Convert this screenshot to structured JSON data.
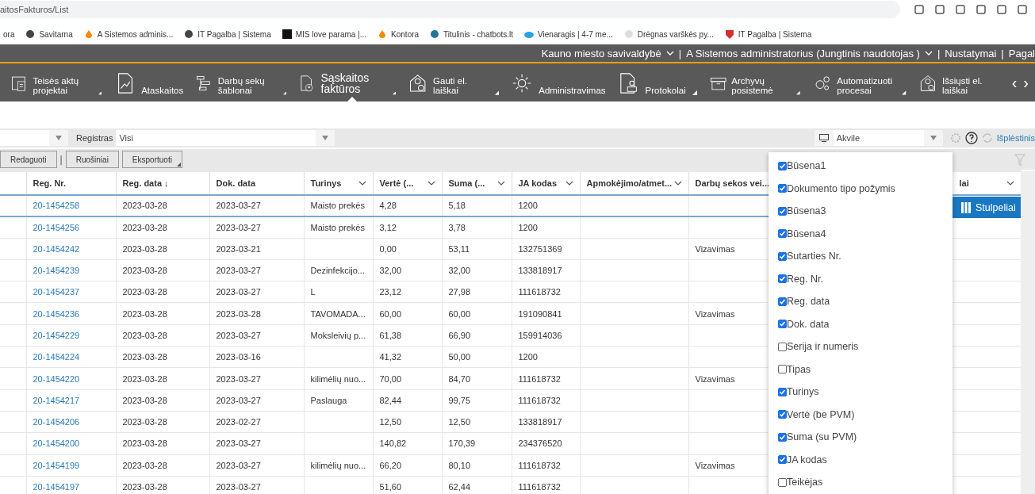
{
  "browser": {
    "url": "aitosFakturos/List",
    "bookmarks": [
      "ora",
      "Savitarna",
      "A Sistemos adminis...",
      "IT Pagalba | Sistema",
      "MIS love parama |...",
      "Kontora",
      "Titulinis - chatbots.lt",
      "Vienaragis | 4-7 me...",
      "Drėgnas varškės py...",
      "IT Pagalba | Sistema"
    ]
  },
  "top_bar": {
    "items": [
      "Kauno miesto savivaldybė",
      "A Sistemos administratorius (Jungtinis naudotojas )",
      "Nustatymai",
      "Pagal"
    ],
    "separator": "|"
  },
  "nav": {
    "items": [
      {
        "label": "Teisės aktų projektai",
        "caret": true,
        "selected": false
      },
      {
        "label": "Ataskaitos",
        "caret": false,
        "selected": false
      },
      {
        "label": "Darbų sekų šablonai",
        "caret": true,
        "selected": false
      },
      {
        "label": "Sąskaitos faktūros",
        "caret": true,
        "selected": true
      },
      {
        "label": "Gauti el. laiškai",
        "caret": true,
        "selected": false
      },
      {
        "label": "Administravimas",
        "caret": false,
        "selected": false
      },
      {
        "label": "Protokolai",
        "caret": true,
        "selected": false
      },
      {
        "label": "Archyvų posistemė",
        "caret": true,
        "selected": false
      },
      {
        "label": "Automatizuoti procesai",
        "caret": true,
        "selected": false
      },
      {
        "label": "Išsiųsti el. laiškai",
        "caret": false,
        "selected": false
      }
    ],
    "prev": "‹",
    "next": "›"
  },
  "filters": {
    "registras_label": "Registras",
    "registras_value": "Visi",
    "user_value": "Akvile",
    "advanced_link": "Išplėstinis"
  },
  "toolbar": {
    "buttons": [
      "Redaguoti",
      "Ruošiniai",
      "Eksportuoti"
    ],
    "separator": "|"
  },
  "table": {
    "columns": [
      {
        "label": "Reg. Nr.",
        "menu": false
      },
      {
        "label": "Reg. data",
        "sort_indicator": "↓",
        "menu": false
      },
      {
        "label": "Dok. data",
        "menu": false
      },
      {
        "label": "Turinys",
        "menu": true
      },
      {
        "label": "Vertė (...",
        "menu": true
      },
      {
        "label": "Suma (...",
        "menu": true
      },
      {
        "label": "JA kodas",
        "menu": true
      },
      {
        "label": "Apmokėjimo/atmet...",
        "menu": true
      },
      {
        "label": "Darbų sekos vei...",
        "menu": false
      },
      {
        "label": "lai",
        "menu": true
      }
    ],
    "rows": [
      {
        "selected": true,
        "cells": [
          "20-1454258",
          "2023-03-28",
          "2023-03-27",
          "Maisto prekės",
          "4,28",
          "5,18",
          "1200",
          "",
          ""
        ]
      },
      {
        "selected": false,
        "cells": [
          "20-1454256",
          "2023-03-28",
          "2023-03-27",
          "Maisto prekės",
          "3,12",
          "3,78",
          "1200",
          "",
          ""
        ]
      },
      {
        "selected": false,
        "cells": [
          "20-1454242",
          "2023-03-28",
          "2023-03-21",
          "",
          "0,00",
          "53,11",
          "132751369",
          "",
          "Vizavimas"
        ]
      },
      {
        "selected": false,
        "cells": [
          "20-1454239",
          "2023-03-28",
          "2023-03-27",
          "Dezinfekcijo...",
          "32,00",
          "32,00",
          "133818917",
          "",
          ""
        ]
      },
      {
        "selected": false,
        "cells": [
          "20-1454237",
          "2023-03-28",
          "2023-03-27",
          "L",
          "23,12",
          "27,98",
          "111618732",
          "",
          ""
        ]
      },
      {
        "selected": false,
        "cells": [
          "20-1454236",
          "2023-03-28",
          "2023-03-28",
          "TAVOMADA...",
          "60,00",
          "60,00",
          "191090841",
          "",
          "Vizavimas"
        ]
      },
      {
        "selected": false,
        "cells": [
          "20-1454229",
          "2023-03-28",
          "2023-03-27",
          "Moksleivių p...",
          "61,38",
          "66,90",
          "159914036",
          "",
          ""
        ]
      },
      {
        "selected": false,
        "cells": [
          "20-1454224",
          "2023-03-28",
          "2023-03-16",
          "",
          "41,32",
          "50,00",
          "1200",
          "",
          ""
        ]
      },
      {
        "selected": false,
        "cells": [
          "20-1454220",
          "2023-03-28",
          "2023-03-27",
          "kilimėlių nuo...",
          "70,00",
          "84,70",
          "111618732",
          "",
          "Vizavimas"
        ]
      },
      {
        "selected": false,
        "cells": [
          "20-1454217",
          "2023-03-28",
          "2023-03-27",
          "Paslauga",
          "82,44",
          "99,75",
          "111618732",
          "",
          ""
        ]
      },
      {
        "selected": false,
        "cells": [
          "20-1454206",
          "2023-03-28",
          "2023-02-27",
          "",
          "12,50",
          "12,50",
          "133818917",
          "",
          ""
        ]
      },
      {
        "selected": false,
        "cells": [
          "20-1454200",
          "2023-03-28",
          "2023-03-27",
          "",
          "140,82",
          "170,39",
          "234376520",
          "",
          ""
        ]
      },
      {
        "selected": false,
        "cells": [
          "20-1454199",
          "2023-03-28",
          "2023-03-27",
          "kilimėlių nuo...",
          "66,20",
          "80,10",
          "111618732",
          "",
          "Vizavimas"
        ]
      },
      {
        "selected": false,
        "cells": [
          "20-1454197",
          "2023-03-28",
          "2023-03-27",
          "",
          "51,60",
          "62,44",
          "111618732",
          "",
          ""
        ]
      }
    ]
  },
  "columns_button": {
    "label": "Stulpeliai"
  },
  "column_menu": {
    "items": [
      {
        "label": "Būsena1",
        "checked": true
      },
      {
        "label": "Dokumento tipo požymis",
        "checked": true
      },
      {
        "label": "Būsena3",
        "checked": true
      },
      {
        "label": "Būsena4",
        "checked": true
      },
      {
        "label": "Sutarties Nr.",
        "checked": true
      },
      {
        "label": "Reg. Nr.",
        "checked": true
      },
      {
        "label": "Reg. data",
        "checked": true
      },
      {
        "label": "Dok. data",
        "checked": true
      },
      {
        "label": "Serija ir numeris",
        "checked": false
      },
      {
        "label": "Tipas",
        "checked": false
      },
      {
        "label": "Turinys",
        "checked": true
      },
      {
        "label": "Vertė (be PVM)",
        "checked": true
      },
      {
        "label": "Suma (su PVM)",
        "checked": true
      },
      {
        "label": "JA kodas",
        "checked": true
      },
      {
        "label": "Teikėjas",
        "checked": false
      }
    ]
  }
}
